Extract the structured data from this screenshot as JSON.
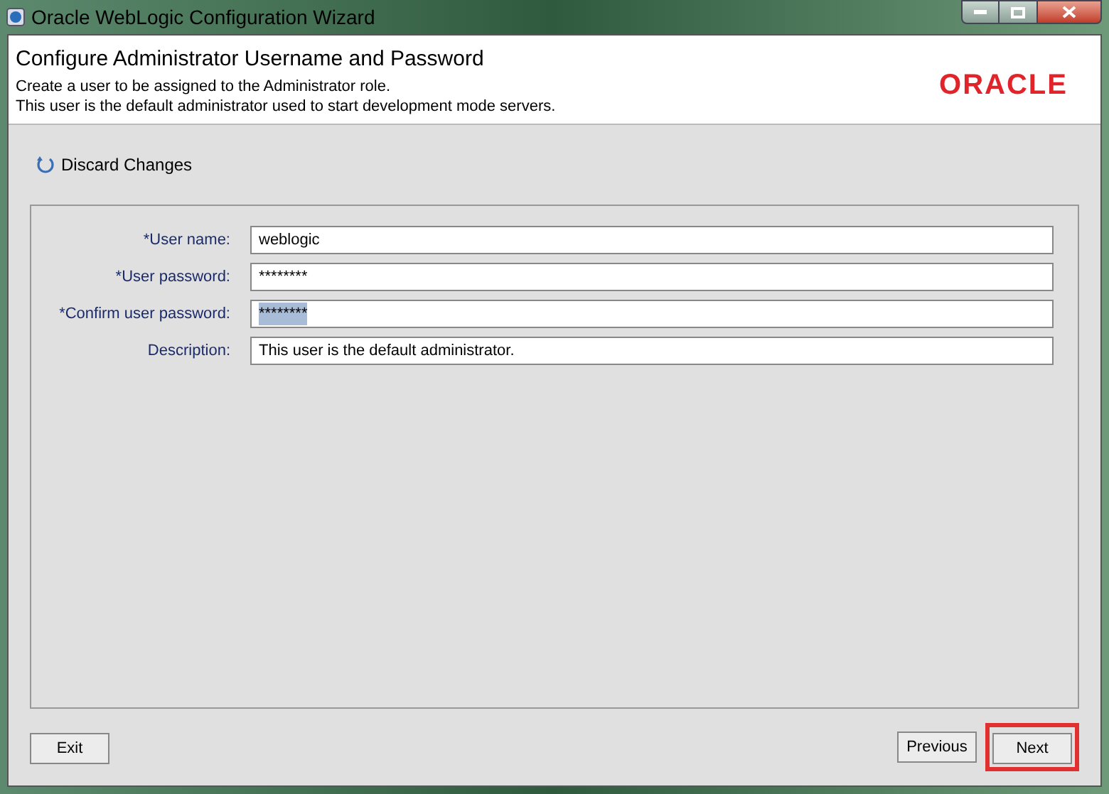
{
  "window": {
    "title": "Oracle WebLogic Configuration Wizard"
  },
  "header": {
    "title": "Configure Administrator Username and Password",
    "lines": [
      "Create a user to be assigned to the Administrator role.",
      "This user is the default administrator used to start development mode servers."
    ],
    "logo": "ORACLE"
  },
  "discard": {
    "label": "Discard Changes"
  },
  "fields": [
    {
      "label": "*User name:",
      "value": "weblogic",
      "text_selected": false
    },
    {
      "label": "*User password:",
      "value": "********",
      "text_selected": false
    },
    {
      "label": "*Confirm user password:",
      "value": "********",
      "text_selected": true
    },
    {
      "label": "Description:",
      "value": "This user is the default administrator.",
      "text_selected": false
    }
  ],
  "buttons": [
    {
      "label": "Exit",
      "highlighted": false
    },
    {
      "label": "Previous",
      "highlighted": false
    },
    {
      "label": "Next",
      "highlighted": true
    }
  ]
}
